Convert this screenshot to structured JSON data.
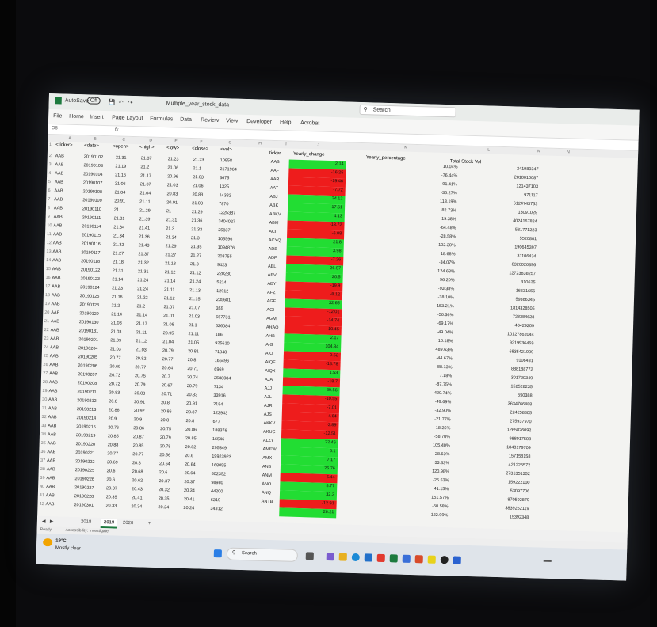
{
  "window": {
    "autosave": "AutoSave",
    "autosave_state": "Off",
    "title": "Multiple_year_stock_data",
    "search": "Search"
  },
  "menu": [
    "File",
    "Home",
    "Insert",
    "Page Layout",
    "Formulas",
    "Data",
    "Review",
    "View",
    "Developer",
    "Help",
    "Acrobat"
  ],
  "name_box": "O8",
  "fx": "fx",
  "columns": [
    "A",
    "B",
    "C",
    "D",
    "E",
    "F",
    "G",
    "H",
    "I",
    "J",
    "K",
    "L",
    "M",
    "N"
  ],
  "headers": {
    "ticker": "<ticker>",
    "date": "<date>",
    "open": "<open>",
    "high": "<high>",
    "low": "<low>",
    "close": "<close>",
    "vol": "<vol>",
    "ticker2": "ticker",
    "yearly_change": "Yearly_change",
    "yearly_percentage": "Yearly_percentage",
    "total_stock_vol": "Total Stock Vol"
  },
  "rows": [
    {
      "t": "AAB",
      "d": "20190102",
      "o": "21.31",
      "h": "21.37",
      "l": "21.23",
      "c": "21.23",
      "v": "10958",
      "tk": "AAB",
      "yc": "2.14",
      "yp": "10.04%",
      "tv": "241980347",
      "pos": true
    },
    {
      "t": "AAB",
      "d": "20190103",
      "o": "21.19",
      "h": "21.2",
      "l": "21.06",
      "c": "21.1",
      "v": "2171964",
      "tk": "AAF",
      "yc": "-16.25",
      "yp": "-76.44%",
      "tv": "2818010087",
      "pos": false
    },
    {
      "t": "AAB",
      "d": "20190104",
      "o": "21.15",
      "h": "21.17",
      "l": "20.96",
      "c": "21.03",
      "v": "3675",
      "tk": "AAR",
      "yc": "-19.46",
      "yp": "-91.41%",
      "tv": "121437103",
      "pos": false
    },
    {
      "t": "AAB",
      "d": "20190107",
      "o": "21.06",
      "h": "21.07",
      "l": "21.03",
      "c": "21.06",
      "v": "1325",
      "tk": "AAT",
      "yc": "-7.72",
      "yp": "-36.27%",
      "tv": "971117",
      "pos": false
    },
    {
      "t": "AAB",
      "d": "20190108",
      "o": "21.04",
      "h": "21.04",
      "l": "20.83",
      "c": "20.83",
      "v": "14382",
      "tk": "ABJ",
      "yc": "24.12",
      "yp": "113.19%",
      "tv": "6124743753",
      "pos": true
    },
    {
      "t": "AAB",
      "d": "20190109",
      "o": "20.91",
      "h": "21.11",
      "l": "20.91",
      "c": "21.03",
      "v": "7870",
      "tk": "ABK",
      "yc": "17.61",
      "yp": "82.73%",
      "tv": "13091029",
      "pos": true
    },
    {
      "t": "AAB",
      "d": "20190110",
      "o": "21",
      "h": "21.29",
      "l": "21",
      "c": "21.29",
      "v": "1225387",
      "tk": "ABKV",
      "yc": "4.13",
      "yp": "19.38%",
      "tv": "4024167824",
      "pos": true
    },
    {
      "t": "AAB",
      "d": "20190111",
      "o": "21.31",
      "h": "21.39",
      "l": "21.31",
      "c": "21.36",
      "v": "3404027",
      "tk": "ABM",
      "yc": "-13.72",
      "yp": "-64.48%",
      "tv": "581771223",
      "pos": false
    },
    {
      "t": "AAB",
      "d": "20190114",
      "o": "21.34",
      "h": "21.41",
      "l": "21.3",
      "c": "21.33",
      "v": "25837",
      "tk": "ACI",
      "yc": "-6.08",
      "yp": "-28.58%",
      "tv": "5520801",
      "pos": false
    },
    {
      "t": "AAB",
      "d": "20190115",
      "o": "21.34",
      "h": "21.36",
      "l": "21.24",
      "c": "21.3",
      "v": "105596",
      "tk": "ACYQ",
      "yc": "21.8",
      "yp": "102.30%",
      "tv": "190645397",
      "pos": true
    },
    {
      "t": "AAB",
      "d": "20190116",
      "o": "21.32",
      "h": "21.43",
      "l": "21.29",
      "c": "21.35",
      "v": "1094876",
      "tk": "ADB",
      "yc": "3.98",
      "yp": "18.68%",
      "tv": "31106434",
      "pos": true
    },
    {
      "t": "AAB",
      "d": "20190117",
      "o": "21.27",
      "h": "21.37",
      "l": "21.27",
      "c": "21.27",
      "v": "203755",
      "tk": "ADF",
      "yc": "-7.26",
      "yp": "-34.07%",
      "tv": "8326026396",
      "pos": false
    },
    {
      "t": "AAB",
      "d": "20190118",
      "o": "21.18",
      "h": "21.32",
      "l": "21.18",
      "c": "21.3",
      "v": "9423",
      "tk": "AEL",
      "yc": "26.57",
      "yp": "124.68%",
      "tv": "12723838257",
      "pos": true
    },
    {
      "t": "AAB",
      "d": "20190122",
      "o": "21.31",
      "h": "21.31",
      "l": "21.12",
      "c": "21.12",
      "v": "220280",
      "tk": "AEV",
      "yc": "20.5",
      "yp": "96.20%",
      "tv": "310625",
      "pos": true
    },
    {
      "t": "AAB",
      "d": "20190123",
      "o": "21.14",
      "h": "21.24",
      "l": "21.14",
      "c": "21.24",
      "v": "5214",
      "tk": "AEY",
      "yc": "-19.9",
      "yp": "-93.38%",
      "tv": "16631656",
      "pos": false
    },
    {
      "t": "AAB",
      "d": "20190124",
      "o": "21.23",
      "h": "21.24",
      "l": "21.11",
      "c": "21.13",
      "v": "12912",
      "tk": "AFZ",
      "yc": "-8.12",
      "yp": "-38.10%",
      "tv": "59386345",
      "pos": false
    },
    {
      "t": "AAB",
      "d": "20190125",
      "o": "21.16",
      "h": "21.22",
      "l": "21.12",
      "c": "21.15",
      "v": "235681",
      "tk": "AGF",
      "yc": "32.65",
      "yp": "153.21%",
      "tv": "1814328505",
      "pos": true
    },
    {
      "t": "AAB",
      "d": "20190128",
      "o": "21.2",
      "h": "21.2",
      "l": "21.07",
      "c": "21.07",
      "v": "355",
      "tk": "AGI",
      "yc": "-12.01",
      "yp": "-56.36%",
      "tv": "728384628",
      "pos": false
    },
    {
      "t": "AAB",
      "d": "20190129",
      "o": "21.14",
      "h": "21.14",
      "l": "21.01",
      "c": "21.03",
      "v": "557731",
      "tk": "AGM",
      "yc": "-14.74",
      "yp": "-69.17%",
      "tv": "48429209",
      "pos": false
    },
    {
      "t": "AAB",
      "d": "20190130",
      "o": "21.08",
      "h": "21.17",
      "l": "21.08",
      "c": "21.1",
      "v": "526084",
      "tk": "AHAO",
      "yc": "-10.45",
      "yp": "-49.04%",
      "tv": "10127862044",
      "pos": false
    },
    {
      "t": "AAB",
      "d": "20190131",
      "o": "21.03",
      "h": "21.11",
      "l": "20.95",
      "c": "21.11",
      "v": "186",
      "tk": "AHB",
      "yc": "2.17",
      "yp": "10.18%",
      "tv": "9219936469",
      "pos": true
    },
    {
      "t": "AAB",
      "d": "20190201",
      "o": "21.09",
      "h": "21.12",
      "l": "21.04",
      "c": "21.05",
      "v": "925610",
      "tk": "AIG",
      "yc": "104.34",
      "yp": "489.63%",
      "tv": "6835421909",
      "pos": true
    },
    {
      "t": "AAB",
      "d": "20190204",
      "o": "21.03",
      "h": "21.03",
      "l": "20.79",
      "c": "20.81",
      "v": "71848",
      "tk": "AIO",
      "yc": "-9.52",
      "yp": "-44.67%",
      "tv": "9106431",
      "pos": false
    },
    {
      "t": "AAB",
      "d": "20190205",
      "o": "20.77",
      "h": "20.82",
      "l": "20.77",
      "c": "20.8",
      "v": "166496",
      "tk": "AIQF",
      "yc": "-18.78",
      "yp": "-88.13%",
      "tv": "888188772",
      "pos": false
    },
    {
      "t": "AAB",
      "d": "20190206",
      "o": "20.69",
      "h": "20.77",
      "l": "20.64",
      "c": "20.71",
      "v": "6969",
      "tk": "AIQX",
      "yc": "1.53",
      "yp": "7.18%",
      "tv": "301720349",
      "pos": true
    },
    {
      "t": "AAB",
      "d": "20190207",
      "o": "20.73",
      "h": "20.75",
      "l": "20.7",
      "c": "20.74",
      "v": "2588084",
      "tk": "AJA",
      "yc": "-18.7",
      "yp": "-87.75%",
      "tv": "152528235",
      "pos": false
    },
    {
      "t": "AAB",
      "d": "20190208",
      "o": "20.72",
      "h": "20.79",
      "l": "20.67",
      "c": "20.79",
      "v": "7134",
      "tk": "AJJ",
      "yc": "89.56",
      "yp": "420.74%",
      "tv": "550388",
      "pos": true
    },
    {
      "t": "AAB",
      "d": "20190211",
      "o": "20.83",
      "h": "20.83",
      "l": "20.71",
      "c": "20.83",
      "v": "33916",
      "tk": "AJL",
      "yc": "-10.55",
      "yp": "-49.69%",
      "tv": "3634766488",
      "pos": false
    },
    {
      "t": "AAB",
      "d": "20190212",
      "o": "20.8",
      "h": "20.91",
      "l": "20.8",
      "c": "20.91",
      "v": "2184",
      "tk": "AJR",
      "yc": "-7.01",
      "yp": "-32.90%",
      "tv": "224258805",
      "pos": false
    },
    {
      "t": "AAB",
      "d": "20190213",
      "o": "20.86",
      "h": "20.92",
      "l": "20.86",
      "c": "20.87",
      "v": "123943",
      "tk": "AJS",
      "yc": "-4.64",
      "yp": "-21.77%",
      "tv": "275937970",
      "pos": false
    },
    {
      "t": "AAB",
      "d": "20190214",
      "o": "20.9",
      "h": "20.9",
      "l": "20.8",
      "c": "20.8",
      "v": "677",
      "tk": "AKKV",
      "yc": "-3.89",
      "yp": "-18.25%",
      "tv": "1265826092",
      "pos": false
    },
    {
      "t": "AAB",
      "d": "20190215",
      "o": "20.76",
      "h": "20.86",
      "l": "20.75",
      "c": "20.86",
      "v": "188376",
      "tk": "AKUC",
      "yc": "-12.51",
      "yp": "-58.70%",
      "tv": "988017508",
      "pos": false
    },
    {
      "t": "AAB",
      "d": "20190219",
      "o": "20.85",
      "h": "20.87",
      "l": "20.79",
      "c": "20.85",
      "v": "16546",
      "tk": "ALZY",
      "yc": "22.46",
      "yp": "105.40%",
      "tv": "1848179709",
      "pos": true
    },
    {
      "t": "AAB",
      "d": "20190220",
      "o": "20.88",
      "h": "20.85",
      "l": "20.78",
      "c": "20.82",
      "v": "295349",
      "tk": "AMEW",
      "yc": "6.1",
      "yp": "28.63%",
      "tv": "157158158",
      "pos": true
    },
    {
      "t": "AAB",
      "d": "20190221",
      "o": "20.77",
      "h": "20.77",
      "l": "20.56",
      "c": "20.6",
      "v": "19923923",
      "tk": "AMX",
      "yc": "7.17",
      "yp": "33.83%",
      "tv": "421225572",
      "pos": true
    },
    {
      "t": "AAB",
      "d": "20190222",
      "o": "20.69",
      "h": "20.8",
      "l": "20.64",
      "c": "20.64",
      "v": "168055",
      "tk": "ANB",
      "yc": "25.76",
      "yp": "120.98%",
      "tv": "2731351352",
      "pos": true
    },
    {
      "t": "AAB",
      "d": "20190225",
      "o": "20.6",
      "h": "20.68",
      "l": "20.6",
      "c": "20.64",
      "v": "802352",
      "tk": "ANM",
      "yc": "-5.44",
      "yp": "-25.53%",
      "tv": "159222100",
      "pos": false
    },
    {
      "t": "AAB",
      "d": "20190226",
      "o": "20.6",
      "h": "20.62",
      "l": "20.37",
      "c": "20.37",
      "v": "98980",
      "tk": "ANO",
      "yc": "8.77",
      "yp": "41.15%",
      "tv": "53097706",
      "pos": true
    },
    {
      "t": "AAB",
      "d": "20190227",
      "o": "20.37",
      "h": "20.43",
      "l": "20.32",
      "c": "20.34",
      "v": "44200",
      "tk": "ANQ",
      "yc": "32.3",
      "yp": "151.57%",
      "tv": "870592879",
      "pos": true
    },
    {
      "t": "AAB",
      "d": "20190228",
      "o": "20.35",
      "h": "20.41",
      "l": "20.35",
      "c": "20.41",
      "v": "6319",
      "tk": "ANTB",
      "yc": "-12.91",
      "yp": "-60.58%",
      "tv": "3839262119",
      "pos": false
    },
    {
      "t": "AAB",
      "d": "20190301",
      "o": "20.33",
      "h": "20.34",
      "l": "20.24",
      "c": "20.24",
      "v": "34312",
      "tk": "",
      "yc": "26.21",
      "yp": "122.99%",
      "tv": "15392348",
      "pos": true
    }
  ],
  "sheets": [
    "2018",
    "2019",
    "2020"
  ],
  "status": {
    "ready": "Ready",
    "accessibility": "Accessibility: Investigate"
  },
  "taskbar": {
    "temp": "19°C",
    "weather": "Mostly clear",
    "search": "Search"
  },
  "colors": {
    "pos": "#22dd33",
    "neg": "#ee1c1c"
  }
}
